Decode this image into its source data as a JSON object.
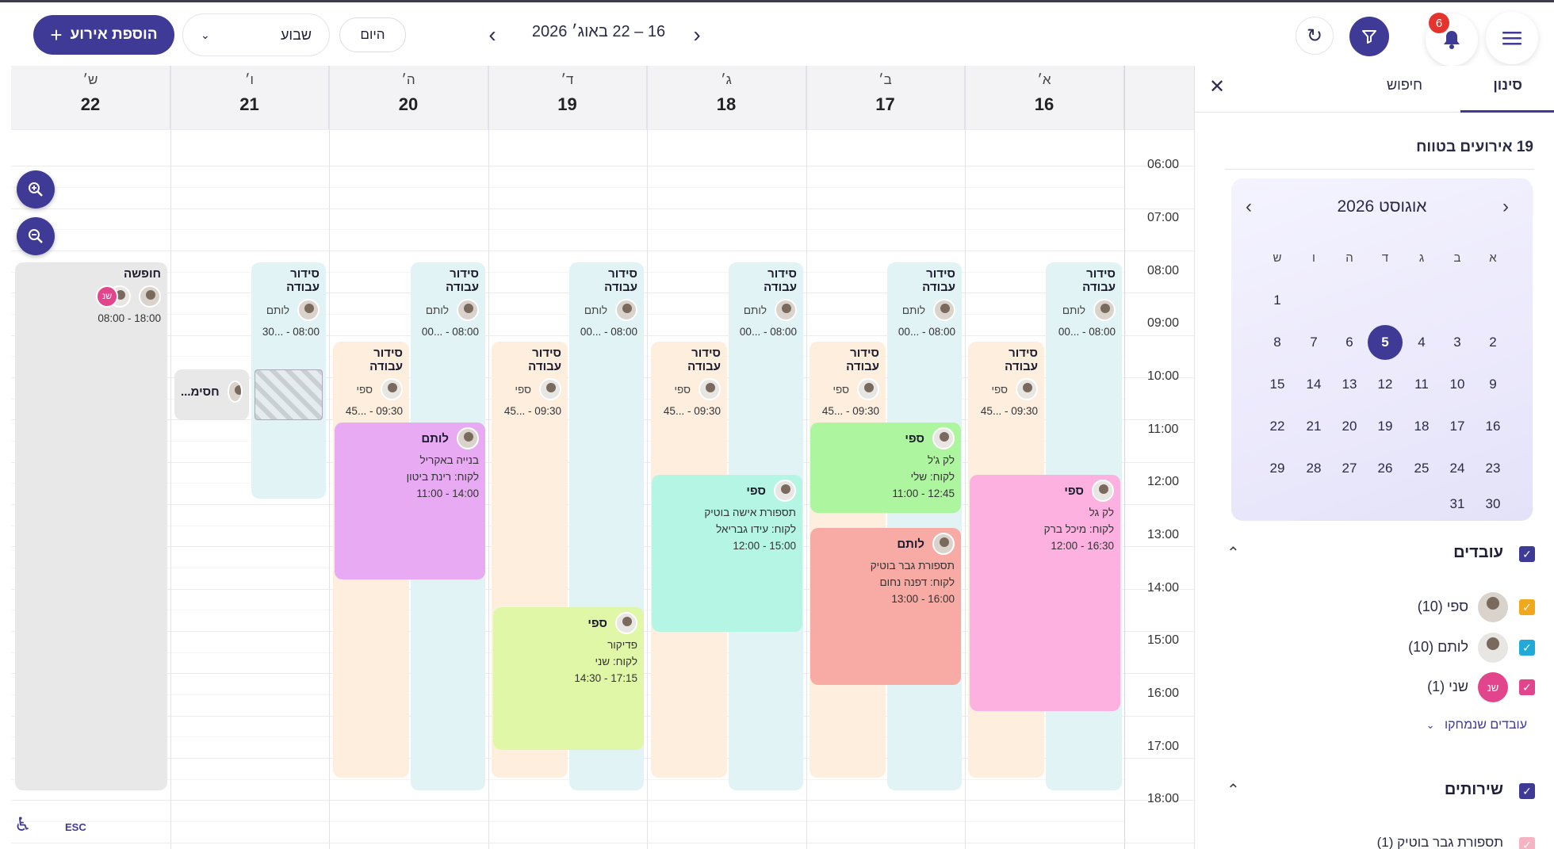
{
  "toolbar": {
    "add_event_label": "הוספת אירוע",
    "view_value": "שבוע",
    "today_label": "היום",
    "range_title": "16 – 22 באוג׳ 2026",
    "notifications_count": "6"
  },
  "days": [
    {
      "name": "א׳",
      "date": "16"
    },
    {
      "name": "ב׳",
      "date": "17"
    },
    {
      "name": "ג׳",
      "date": "18"
    },
    {
      "name": "ד׳",
      "date": "19"
    },
    {
      "name": "ה׳",
      "date": "20"
    },
    {
      "name": "ו׳",
      "date": "21"
    },
    {
      "name": "ש׳",
      "date": "22"
    }
  ],
  "hours": [
    "06:00",
    "07:00",
    "08:00",
    "09:00",
    "10:00",
    "11:00",
    "12:00",
    "13:00",
    "14:00",
    "15:00",
    "16:00",
    "17:00",
    "18:00"
  ],
  "shift": {
    "title": "סידור עבודה",
    "lotem": "לותם",
    "safi": "ספי",
    "lotem_time": "08:00 - ...00",
    "lotem_time_fri": "08:00 - ...30",
    "safi_time": "09:30 - ...45"
  },
  "vacation": {
    "title": "חופשה",
    "time": "18:00 - 08:00",
    "initials": "שנ"
  },
  "blocked": {
    "title": "חסימ..."
  },
  "events": {
    "sun": {
      "name": "ספי",
      "service": "לק גל",
      "client": "לקוח: מיכל ברק",
      "time": "16:30 - 12:00"
    },
    "mon1": {
      "name": "ספי",
      "service": "לק ג'ל",
      "client": "לקוח: שלי",
      "time": "12:45 - 11:00"
    },
    "mon2": {
      "name": "לותם",
      "service": "תספורת גבר בוטיק",
      "client": "לקוח: דפנה נחום",
      "time": "16:00 - 13:00"
    },
    "tue": {
      "name": "ספי",
      "service": "תספורת אישה בוטיק",
      "client": "לקוח: עידו גבריאל",
      "time": "15:00 - 12:00"
    },
    "wed": {
      "name": "ספי",
      "service": "פדיקור",
      "client": "לקוח: שני",
      "time": "17:15 - 14:30"
    },
    "thu": {
      "name": "לותם",
      "service": "בנייה באקריל",
      "client": "לקוח: רינת ביטון",
      "time": "14:00 - 11:00"
    }
  },
  "footer": {
    "esc_label": "ESC"
  },
  "panel": {
    "tab_filter": "סינון",
    "tab_search": "חיפוש",
    "events_in_range": "19 אירועים בטווח",
    "mini_calendar": {
      "title": "אוגוסט 2026",
      "weekdays": [
        "א",
        "ב",
        "ג",
        "ד",
        "ה",
        "ו",
        "ש"
      ],
      "weeks": [
        [
          "",
          "",
          "",
          "",
          "",
          "",
          "1"
        ],
        [
          "2",
          "3",
          "4",
          "5",
          "6",
          "7",
          "8"
        ],
        [
          "9",
          "10",
          "11",
          "12",
          "13",
          "14",
          "15"
        ],
        [
          "16",
          "17",
          "18",
          "19",
          "20",
          "21",
          "22"
        ],
        [
          "23",
          "24",
          "25",
          "26",
          "27",
          "28",
          "29"
        ],
        [
          "30",
          "31",
          "",
          "",
          "",
          "",
          ""
        ]
      ],
      "selected": "5"
    },
    "employees_title": "עובדים",
    "employees": [
      {
        "label": "ספי (10)",
        "color": "#f2a81d"
      },
      {
        "label": "לותם (10)",
        "color": "#21a9d8"
      },
      {
        "label": "שני (1)",
        "color": "#e2458c",
        "initials": "שנ"
      }
    ],
    "deleted_employees_label": "עובדים שנמחקו",
    "services_title": "שירותים",
    "services_partial": "תספורת גבר בוטיק (1)"
  },
  "colors": {
    "primary": "#3f3a95",
    "shift_lotem": "#e1f3f5",
    "shift_safi": "#fdeedd",
    "vacation": "#e8e8e8",
    "ev_pink": "#fcb1e0",
    "ev_green": "#adf59f",
    "ev_red": "#f8aaa5",
    "ev_teal": "#b4f5e3",
    "ev_lime": "#e0f7a7",
    "ev_purple": "#e9aaf4"
  }
}
